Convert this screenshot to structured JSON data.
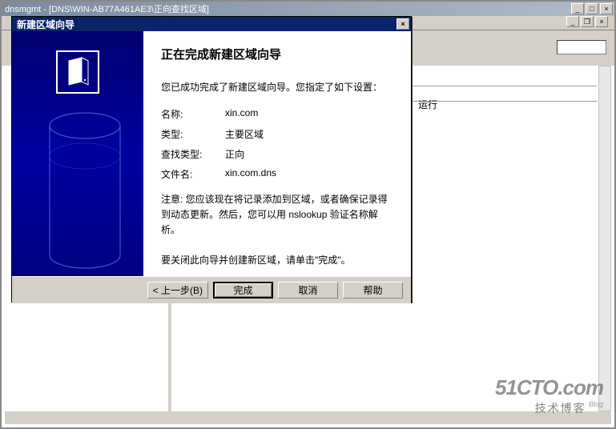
{
  "main_window": {
    "title": "dnsmgmt - [DNS\\WIN-AB77A461AE3\\正向查找区域]"
  },
  "content": {
    "status_text": "运行"
  },
  "dialog": {
    "title": "新建区域向导",
    "heading": "正在完成新建区域向导",
    "intro": "您已成功完成了新建区域向导。您指定了如下设置：",
    "rows": {
      "name_label": "名称:",
      "name_value": "xin.com",
      "type_label": "类型:",
      "type_value": "主要区域",
      "lookup_label": "查找类型:",
      "lookup_value": "正向",
      "file_label": "文件名:",
      "file_value": "xin.com.dns"
    },
    "note": "注意: 您应该现在将记录添加到区域，或者确保记录得到动态更新。然后，您可以用 nslookup 验证名称解析。",
    "close_text": "要关闭此向导并创建新区域，请单击\"完成\"。",
    "buttons": {
      "back": "< 上一步(B)",
      "finish": "完成",
      "cancel": "取消",
      "help": "帮助"
    }
  },
  "watermark": {
    "big": "51CTO.com",
    "small": "技术博客",
    "tiny": "Blog"
  }
}
